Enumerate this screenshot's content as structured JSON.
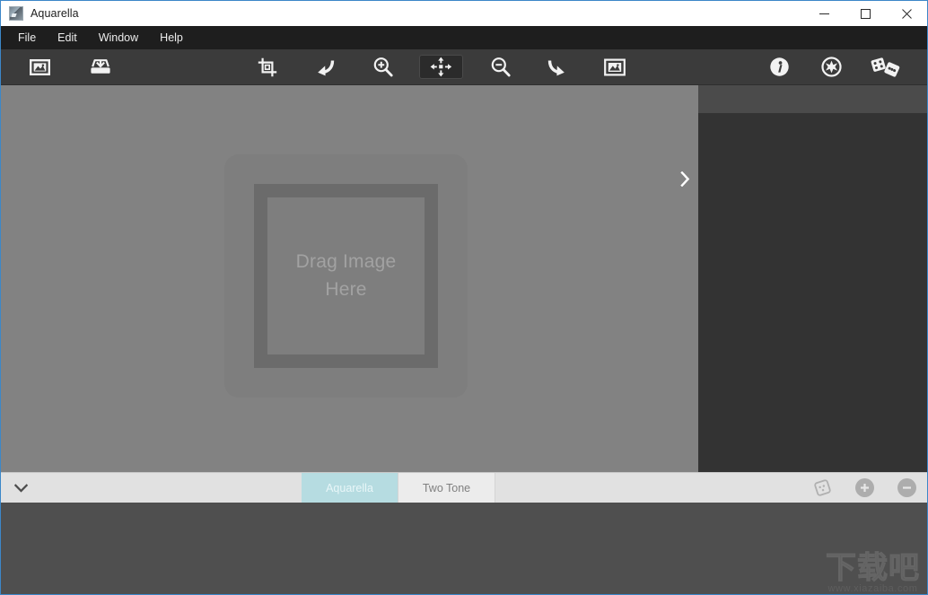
{
  "window": {
    "title": "Aquarella",
    "app_icon": "app-logo-icon",
    "controls": [
      {
        "name": "minimize",
        "glyph": "minimize-icon"
      },
      {
        "name": "maximize",
        "glyph": "maximize-icon"
      },
      {
        "name": "close",
        "glyph": "close-icon"
      }
    ],
    "accent_border": "#3c87c8"
  },
  "menubar": {
    "items": [
      {
        "label": "File"
      },
      {
        "label": "Edit"
      },
      {
        "label": "Window"
      },
      {
        "label": "Help"
      }
    ]
  },
  "toolbar": {
    "background": "#3b3b3b",
    "left_group": [
      {
        "name": "open-image-button",
        "icon": "image-frame-icon",
        "label": "Open Image"
      },
      {
        "name": "save-image-button",
        "icon": "save-tray-icon",
        "label": "Save Image"
      }
    ],
    "center_group": [
      {
        "name": "crop-button",
        "icon": "crop-icon",
        "label": "Crop",
        "active": false
      },
      {
        "name": "undo-button",
        "icon": "undo-arrow-icon",
        "label": "Undo",
        "active": false
      },
      {
        "name": "zoom-in-button",
        "icon": "zoom-in-icon",
        "label": "Zoom In",
        "active": false
      },
      {
        "name": "move-tool-button",
        "icon": "move-arrows-icon",
        "label": "Move",
        "active": true
      },
      {
        "name": "zoom-out-button",
        "icon": "zoom-out-icon",
        "label": "Zoom Out",
        "active": false
      },
      {
        "name": "redo-button",
        "icon": "redo-arrow-icon",
        "label": "Redo",
        "active": false
      },
      {
        "name": "fit-image-button",
        "icon": "fit-image-icon",
        "label": "Fit Image",
        "active": false
      }
    ],
    "right_group": [
      {
        "name": "info-button",
        "icon": "info-circle-icon",
        "label": "Info"
      },
      {
        "name": "settings-button",
        "icon": "settings-burst-icon",
        "label": "Settings"
      },
      {
        "name": "randomize-button",
        "icon": "dice-icon",
        "label": "Randomize"
      }
    ]
  },
  "canvas": {
    "background": "#828282",
    "dropzone": {
      "label_line1": "Drag Image",
      "label_line2": "Here",
      "text_color": "#a2a2a2"
    },
    "panel_toggle": {
      "icon": "chevron-right-icon",
      "label": "Show Panel"
    }
  },
  "sidepanel": {
    "background": "#333333",
    "header_background": "#4b4b4b"
  },
  "filterbar": {
    "background": "#e1e1e1",
    "expander": {
      "icon": "chevron-down-icon",
      "label": "Collapse Presets"
    },
    "tabs": [
      {
        "label": "Aquarella",
        "selected": true
      },
      {
        "label": "Two Tone",
        "selected": false
      }
    ],
    "selected_tab_color": "#b6dce1",
    "actions": [
      {
        "name": "random-preset-button",
        "icon": "dice-icon",
        "label": "Random Preset"
      },
      {
        "name": "add-preset-button",
        "icon": "plus-icon",
        "label": "Add Preset"
      },
      {
        "name": "remove-preset-button",
        "icon": "minus-icon",
        "label": "Remove Preset"
      }
    ]
  },
  "previewstrip": {
    "background": "#4f4f4f",
    "watermark_main": "下载吧",
    "watermark_sub": "www.xiazaiba.com"
  }
}
